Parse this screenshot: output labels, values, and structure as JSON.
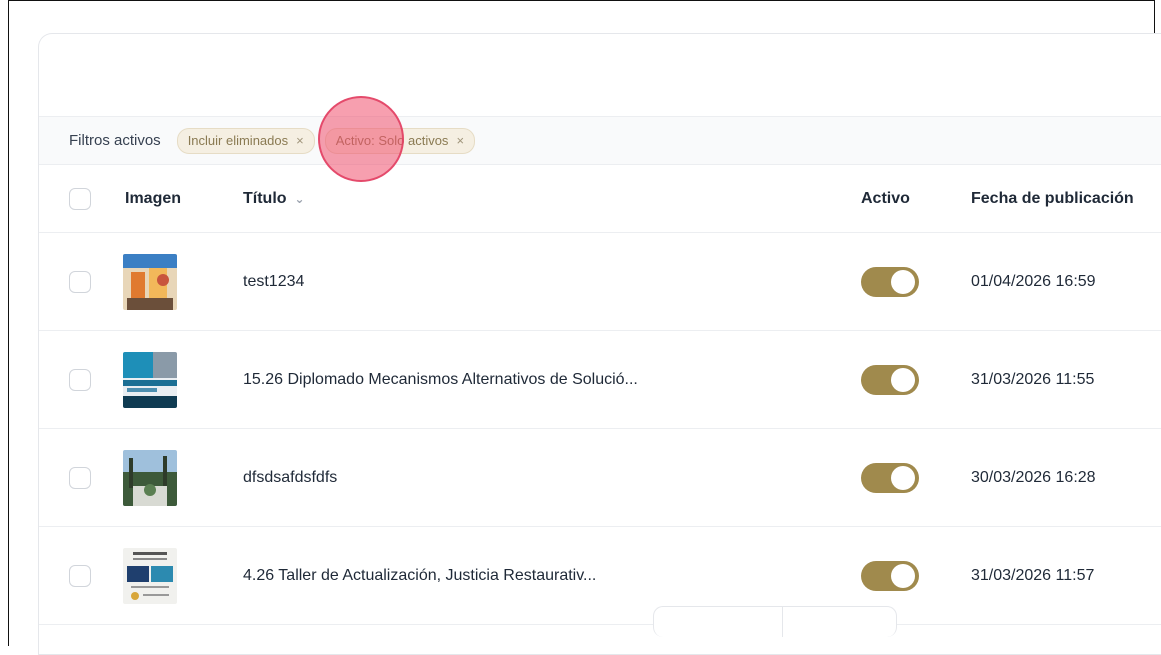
{
  "filters": {
    "label": "Filtros activos",
    "chips": [
      {
        "label": "Incluir eliminados"
      },
      {
        "label": "Activo: Solo activos"
      }
    ]
  },
  "table": {
    "columns": {
      "image": "Imagen",
      "title": "Título",
      "active": "Activo",
      "published": "Fecha de publicación"
    },
    "rows": [
      {
        "title": "test1234",
        "active": true,
        "date": "01/04/2026 16:59"
      },
      {
        "title": "15.26 Diplomado Mecanismos Alternativos de Solució...",
        "active": true,
        "date": "31/03/2026 11:55"
      },
      {
        "title": "dfsdsafdsfdfs",
        "active": true,
        "date": "30/03/2026 16:28"
      },
      {
        "title": "4.26 Taller de Actualización, Justicia Restaurativ...",
        "active": true,
        "date": "31/03/2026 11:57"
      }
    ]
  },
  "colors": {
    "toggle_on": "#a08a4d",
    "chip_bg": "#f5efe2",
    "click_indicator": "#f0506e"
  },
  "icons": {
    "chip_remove": "×",
    "sort": "⌄"
  }
}
